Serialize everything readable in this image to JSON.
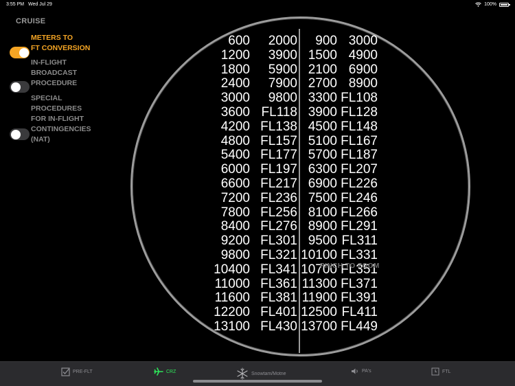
{
  "status": {
    "time": "3:55 PM",
    "date": "Wed Jul 29",
    "battery": "100%"
  },
  "sidebar": {
    "title": "CRUISE",
    "options": [
      {
        "label": "METERS TO\nFT CONVERSION",
        "on": true
      },
      {
        "label": "IN-FLIGHT\nBROADCAST\nPROCEDURE",
        "on": false
      },
      {
        "label": "SPECIAL\nPROCEDURES\nFOR IN-FLIGHT\nCONTINGENCIES\n(NAT)",
        "on": false
      }
    ]
  },
  "conversion_table": {
    "rows": [
      [
        "600",
        "2000",
        "900",
        "3000"
      ],
      [
        "1200",
        "3900",
        "1500",
        "4900"
      ],
      [
        "1800",
        "5900",
        "2100",
        "6900"
      ],
      [
        "2400",
        "7900",
        "2700",
        "8900"
      ],
      [
        "3000",
        "9800",
        "3300",
        "FL108"
      ],
      [
        "3600",
        "FL118",
        "3900",
        "FL128"
      ],
      [
        "4200",
        "FL138",
        "4500",
        "FL148"
      ],
      [
        "4800",
        "FL157",
        "5100",
        "FL167"
      ],
      [
        "5400",
        "FL177",
        "5700",
        "FL187"
      ],
      [
        "6000",
        "FL197",
        "6300",
        "FL207"
      ],
      [
        "6600",
        "FL217",
        "6900",
        "FL226"
      ],
      [
        "7200",
        "FL236",
        "7500",
        "FL246"
      ],
      [
        "7800",
        "FL256",
        "8100",
        "FL266"
      ],
      [
        "8400",
        "FL276",
        "8900",
        "FL291"
      ],
      [
        "9200",
        "FL301",
        "9500",
        "FL311"
      ],
      [
        "9800",
        "FL321",
        "10100",
        "FL331"
      ],
      [
        "10400",
        "FL341",
        "10700",
        "FL351"
      ],
      [
        "11000",
        "FL361",
        "11300",
        "FL371"
      ],
      [
        "11600",
        "FL381",
        "11900",
        "FL391"
      ],
      [
        "12200",
        "FL401",
        "12500",
        "FL411"
      ],
      [
        "13100",
        "FL430",
        "13700",
        "FL449"
      ]
    ],
    "hint": "PINCH TO ZOOM"
  },
  "tabs": [
    {
      "label": "PRE-FLT",
      "icon": "checkbox-icon",
      "active": false
    },
    {
      "label": "CRZ",
      "icon": "airplane-icon",
      "active": true
    },
    {
      "label": "Snowtam/Motne",
      "icon": "snowflake-icon",
      "active": false
    },
    {
      "label": "PA's",
      "icon": "speaker-icon",
      "active": false
    },
    {
      "label": "FTL",
      "icon": "clock-icon",
      "active": false
    }
  ],
  "colors": {
    "accent": "#f5a524",
    "active_tab": "#2ee65a",
    "lens_border": "#9c9c9c"
  }
}
